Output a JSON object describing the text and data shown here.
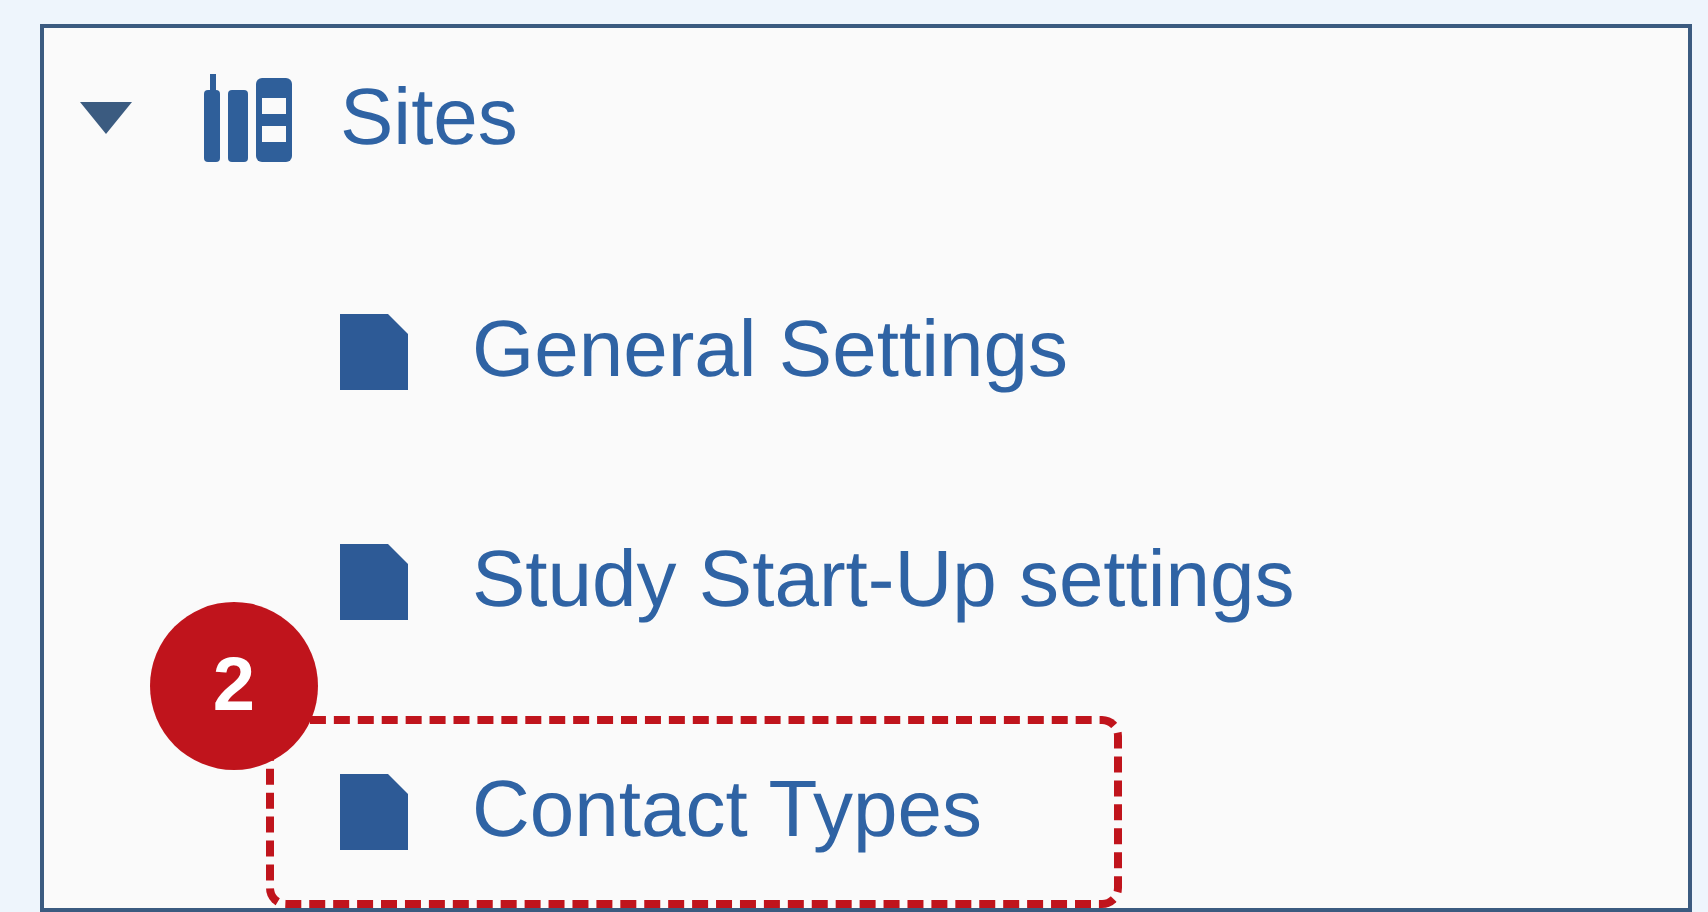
{
  "tree": {
    "label": "Sites",
    "expanded": true,
    "children": [
      {
        "label": "General Settings",
        "highlighted": false
      },
      {
        "label": "Study Start-Up settings",
        "highlighted": false
      },
      {
        "label": "Contact Types",
        "highlighted": true,
        "callout": "2"
      }
    ]
  }
}
